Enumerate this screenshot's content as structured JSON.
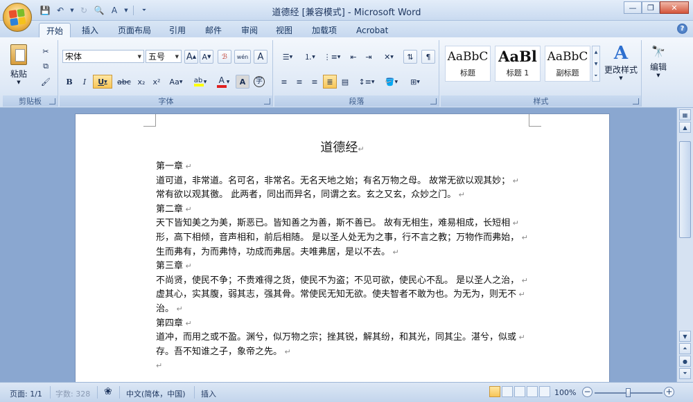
{
  "window": {
    "title": "道德经 [兼容模式] - Microsoft Word"
  },
  "tabs": [
    "开始",
    "插入",
    "页面布局",
    "引用",
    "邮件",
    "审阅",
    "视图",
    "加载项",
    "Acrobat"
  ],
  "ribbon": {
    "clipboard": {
      "paste_label": "粘贴",
      "group_label": "剪贴板"
    },
    "font": {
      "font_name": "宋体",
      "font_size": "五号",
      "group_label": "字体",
      "bold": "B",
      "italic": "I",
      "underline": "U",
      "strike": "abc",
      "subscript": "x₂",
      "superscript": "x²",
      "change_case": "Aa",
      "grow": "A",
      "shrink": "A",
      "phonetic": "wén",
      "charbox": "A"
    },
    "paragraph": {
      "group_label": "段落"
    },
    "styles": {
      "group_label": "样式",
      "items": [
        {
          "sample": "AaBbC",
          "name": "标题"
        },
        {
          "sample": "AaBl",
          "name": "标题 1"
        },
        {
          "sample": "AaBbC",
          "name": "副标题"
        }
      ],
      "change_styles": "更改样式"
    },
    "editing": {
      "label": "编辑"
    }
  },
  "document": {
    "title": "道德经",
    "lines": [
      "第一章",
      "道可道，非常道。名可名，非常名。无名天地之始；有名万物之母。 故常无欲以观其妙；",
      "常有欲以观其徼。 此两者，同出而异名，同谓之玄。玄之又玄，众妙之门。",
      "第二章",
      "天下皆知美之为美，斯恶已。皆知善之为善，斯不善已。 故有无相生，难易相成，长短相",
      "形，高下相倾，音声相和，前后相随。 是以圣人处无为之事，行不言之教；万物作而弗始，",
      "生而弗有，为而弗恃，功成而弗居。夫唯弗居，是以不去。",
      "第三章",
      "不尚贤，使民不争；不贵难得之货，使民不为盗；不见可欲，使民心不乱。 是以圣人之治，",
      "虚其心，实其腹，弱其志，强其骨。常使民无知无欲。使夫智者不敢为也。为无为，则无不",
      "治。",
      "第四章",
      "道冲，而用之或不盈。渊兮，似万物之宗；挫其锐，解其纷，和其光，同其尘。湛兮，似或",
      "存。吾不知谁之子，象帝之先。",
      ""
    ]
  },
  "statusbar": {
    "page": "页面: 1/1",
    "words": "字数: 328",
    "language": "中文(简体，中国)",
    "mode": "插入",
    "zoom": "100%",
    "zoom_fraction": 0.5
  }
}
